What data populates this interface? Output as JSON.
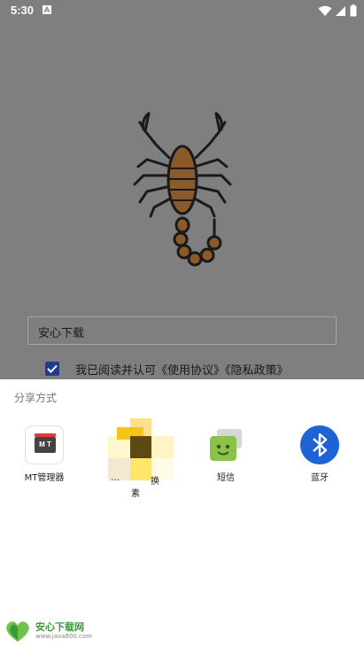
{
  "status_bar": {
    "time": "5:30",
    "icons": [
      "notification-a-icon",
      "wifi-icon",
      "signal-icon",
      "battery-icon"
    ]
  },
  "background_app": {
    "illustration": "scorpion-icon",
    "input_value": "安心下载",
    "agreement_text": "我已阅读并认可《使用协议》《隐私政策》",
    "agreement_checked": true
  },
  "share_sheet": {
    "title": "分享方式",
    "targets": [
      {
        "label": "MT管理器",
        "icon": "mt-manager-icon"
      },
      {
        "label_parts": [
          "…",
          "换",
          "素"
        ],
        "icon": "mosaic-app-icon"
      },
      {
        "label": "短信",
        "icon": "sms-icon"
      },
      {
        "label": "蓝牙",
        "icon": "bluetooth-icon"
      }
    ]
  },
  "watermark": {
    "title": "安心下载网",
    "url": "www.java800.com"
  },
  "colors": {
    "overlay": "#7f7f7f",
    "checkbox": "#1f3d8a",
    "sms_green": "#8bc34a",
    "bluetooth_blue": "#1e63d6",
    "watermark_green": "#3a9a3a"
  }
}
